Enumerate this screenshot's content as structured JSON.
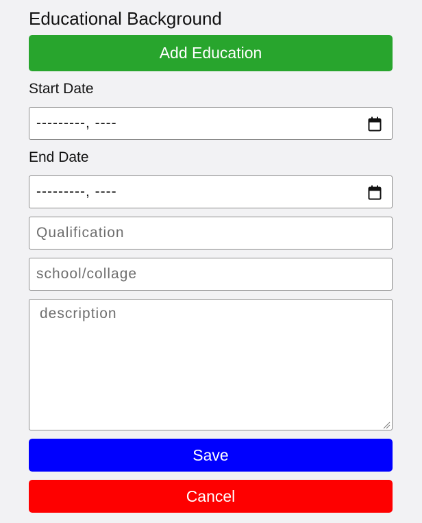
{
  "section": {
    "title": "Educational Background"
  },
  "add_button": {
    "label": "Add Education",
    "color": "#28a52d"
  },
  "start_date": {
    "label": "Start Date",
    "value": "---------,  ----",
    "icon": "calendar-icon"
  },
  "end_date": {
    "label": "End Date",
    "value": "---------,  ----",
    "icon": "calendar-icon"
  },
  "qualification": {
    "placeholder": "Qualification"
  },
  "school": {
    "placeholder": "school/collage"
  },
  "description": {
    "placeholder": "description"
  },
  "save_button": {
    "label": "Save",
    "color": "#0000fe"
  },
  "cancel_button": {
    "label": "Cancel",
    "color": "#fe0000"
  }
}
